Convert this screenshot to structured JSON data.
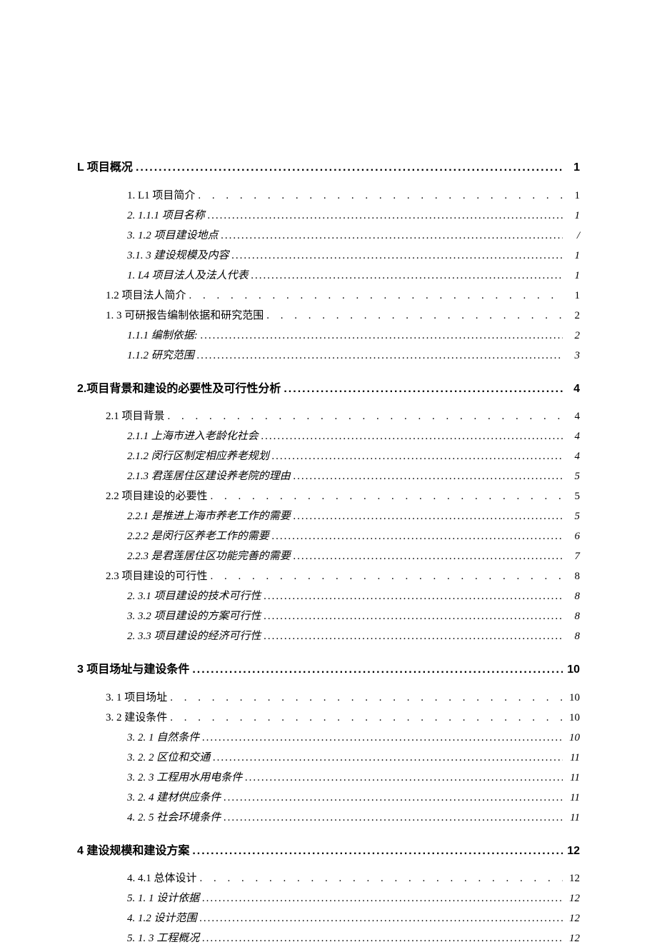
{
  "s1": {
    "t": "L 项目概况",
    "p": "1",
    "items": [
      {
        "lvl": "h3n",
        "t": "1.   L1 项目简介",
        "p": "1",
        "d": "sparse"
      },
      {
        "lvl": "h3",
        "t": "2.   1.1.1 项目名称",
        "p": "1",
        "d": "dense"
      },
      {
        "lvl": "h3",
        "t": "3.   1.2 项目建设地点",
        "p": "/",
        "d": "dense"
      },
      {
        "lvl": "h3",
        "t": "3.1.   3 建设规模及内容",
        "p": "1",
        "d": "dense"
      },
      {
        "lvl": "h3",
        "t": "1.   L4 项目法人及法人代表",
        "p": "1",
        "d": "dense"
      },
      {
        "lvl": "h2",
        "t": "1.2 项目法人简介",
        "p": "1",
        "d": "sparse"
      },
      {
        "lvl": "h2",
        "t": "1.   3 可研报告编制依据和研究范围",
        "p": "2",
        "d": "sparse"
      },
      {
        "lvl": "h3",
        "t": "1.1.1     编制依据:",
        "p": "2",
        "d": "dense"
      },
      {
        "lvl": "h3",
        "t": "1.1.2     研究范围",
        "p": "3",
        "d": "dense"
      }
    ]
  },
  "s2": {
    "t": "2.项目背景和建设的必要性及可行性分析",
    "p": "4",
    "items": [
      {
        "lvl": "h2",
        "t": "2.1    项目背景",
        "p": "4",
        "d": "sparse"
      },
      {
        "lvl": "h3",
        "t": "2.1.1 上海市进入老龄化社会",
        "p": "4",
        "d": "dense"
      },
      {
        "lvl": "h3",
        "t": "2.1.2 闵行区制定相应养老规划",
        "p": "4",
        "d": "dense"
      },
      {
        "lvl": "h3",
        "t": "2.1.3 君莲居住区建设养老院的理由",
        "p": "5",
        "d": "dense"
      },
      {
        "lvl": "h2",
        "t": "2.2 项目建设的必要性",
        "p": "5",
        "d": "sparse"
      },
      {
        "lvl": "h3",
        "t": "2.2.1 是推进上海市养老工作的需要",
        "p": "5",
        "d": "dense"
      },
      {
        "lvl": "h3",
        "t": "2.2.2 是闵行区养老工作的需要",
        "p": "6",
        "d": "dense"
      },
      {
        "lvl": "h3",
        "t": "2.2.3 是君莲居住区功能完善的需要",
        "p": "7",
        "d": "dense"
      },
      {
        "lvl": "h2",
        "t": "2.3 项目建设的可行性",
        "p": "8",
        "d": "sparse"
      },
      {
        "lvl": "h3",
        "t": "2.   3.1 项目建设的技术可行性",
        "p": "8",
        "d": "dense"
      },
      {
        "lvl": "h3",
        "t": "3.   3.2 项目建设的方案可行性",
        "p": "8",
        "d": "dense"
      },
      {
        "lvl": "h3",
        "t": "2.   3.3 项目建设的经济可行性",
        "p": "8",
        "d": "dense"
      }
    ]
  },
  "s3": {
    "t": "3 项目场址与建设条件",
    "p": "10",
    "items": [
      {
        "lvl": "h2",
        "t": "3.   1 项目场址",
        "p": "10",
        "d": "sparse"
      },
      {
        "lvl": "h2",
        "t": "3.   2 建设条件",
        "p": "10",
        "d": "sparse"
      },
      {
        "lvl": "h3",
        "t": "3.   2. 1 自然条件",
        "p": "10",
        "d": "dense"
      },
      {
        "lvl": "h3",
        "t": "3.   2. 2 区位和交通",
        "p": "11",
        "d": "dense"
      },
      {
        "lvl": "h3",
        "t": "3.   2. 3 工程用水用电条件",
        "p": "11",
        "d": "dense"
      },
      {
        "lvl": "h3",
        "t": "3.   2. 4 建材供应条件",
        "p": "11",
        "d": "dense"
      },
      {
        "lvl": "h3",
        "t": "4.   2. 5 社会环境条件",
        "p": "11",
        "d": "dense"
      }
    ]
  },
  "s4": {
    "t": "4 建设规模和建设方案",
    "p": "12",
    "items": [
      {
        "lvl": "h3n",
        "t": "4.   4.1 总体设计",
        "p": "12",
        "d": "sparse"
      },
      {
        "lvl": "h3",
        "t": "5.   1. 1 设计依据",
        "p": "12",
        "d": "dense"
      },
      {
        "lvl": "h3",
        "t": "4.   1.2 设计范围",
        "p": "12",
        "d": "dense"
      },
      {
        "lvl": "h3",
        "t": "5.   1. 3 工程概况",
        "p": "12",
        "d": "dense"
      }
    ]
  }
}
